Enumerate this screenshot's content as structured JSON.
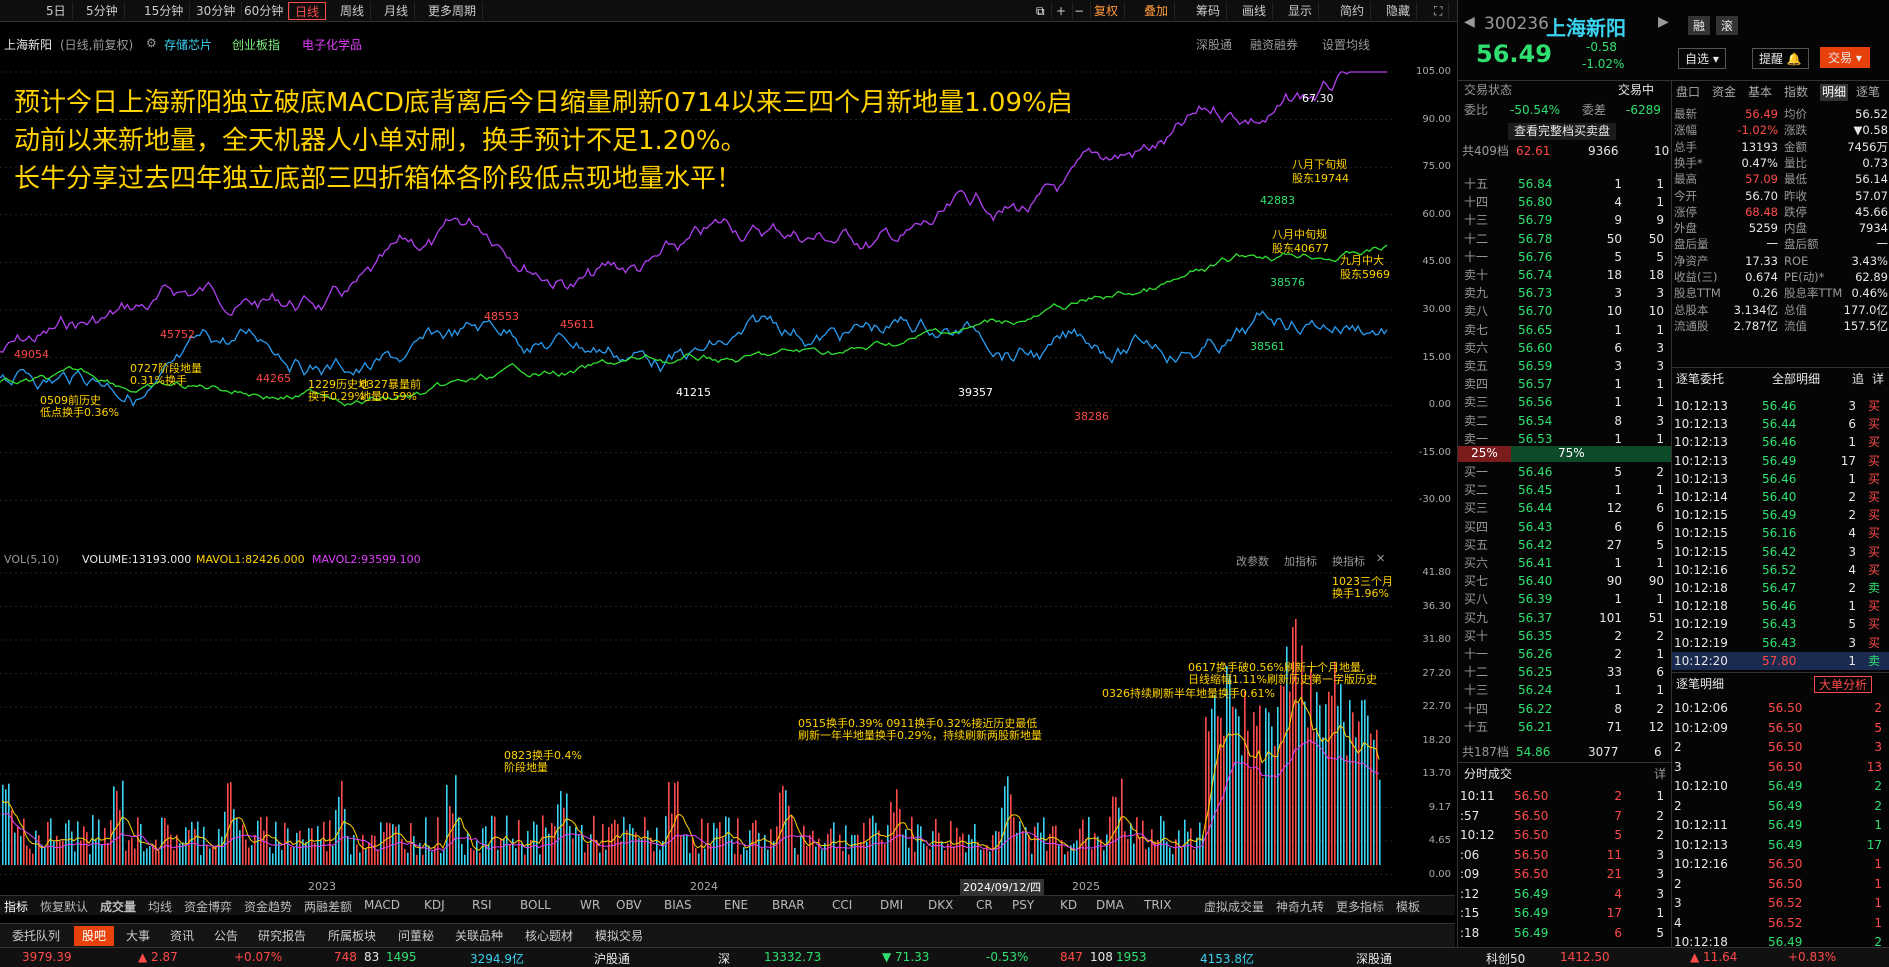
{
  "toolbar": {
    "items": [
      "日线",
      "5日",
      "5分钟",
      "15分钟",
      "30分钟",
      "60分钟",
      "日线",
      "周线",
      "月线",
      "更多周期"
    ],
    "right": [
      "复权",
      "叠加",
      "筹码",
      "画线",
      "显示",
      "简约",
      "隐藏"
    ]
  },
  "chart_header": {
    "stock": "上海新阳",
    "mode": "(日线,前复权)",
    "tags": [
      "存储芯片",
      "创业板指",
      "电子化学品"
    ],
    "right": [
      "深股通",
      "融资融券",
      "设置均线"
    ]
  },
  "announcement": [
    "预计今日上海新阳独立破底MACD底背离后今日缩量刷新0714以来三四个月新地量1.09%启",
    "动前以来新地量，全天机器人小单对刷，换手预计不足1.20%。",
    "长牛分享过去四年独立底部三四折箱体各阶段低点现地量水平！"
  ],
  "price_axis": [
    "105.00",
    "90.00",
    "75.00",
    "60.00",
    "45.00",
    "30.00",
    "15.00",
    "0.00",
    "-15.00",
    "-30.00"
  ],
  "price_annotations": [
    {
      "t": "67.30",
      "c": "white"
    },
    {
      "t": "八月下旬规",
      "c": "yellow"
    },
    {
      "t": "股东19744",
      "c": "yellow"
    },
    {
      "t": "八月中旬规",
      "c": "yellow"
    },
    {
      "t": "股东40677",
      "c": "yellow"
    },
    {
      "t": "九月中大",
      "c": "yellow"
    },
    {
      "t": "股东5969",
      "c": "yellow"
    },
    {
      "t": "42883",
      "c": "green"
    },
    {
      "t": "38576",
      "c": "green"
    },
    {
      "t": "38561",
      "c": "green"
    },
    {
      "t": "0509前历史",
      "c": "yellow"
    },
    {
      "t": "低点换手0.36%",
      "c": "yellow"
    },
    {
      "t": "0727阶段地量",
      "c": "yellow"
    },
    {
      "t": "0.31%换手",
      "c": "yellow"
    },
    {
      "t": "1229历史地",
      "c": "yellow"
    },
    {
      "t": "换手0.29%",
      "c": "yellow"
    },
    {
      "t": "0327暴量前",
      "c": "yellow"
    },
    {
      "t": "地量0.59%",
      "c": "yellow"
    },
    {
      "t": "49054",
      "c": "red"
    },
    {
      "t": "45752",
      "c": "red"
    },
    {
      "t": "44265",
      "c": "red"
    },
    {
      "t": "48553",
      "c": "red"
    },
    {
      "t": "45611",
      "c": "red"
    },
    {
      "t": "41215",
      "c": "white"
    },
    {
      "t": "39357",
      "c": "white"
    },
    {
      "t": "38286",
      "c": "red"
    }
  ],
  "vol_header": {
    "label": "VOL(5,10)",
    "volume": "VOLUME:13193.000",
    "mavol1": "MAVOL1:82426.000",
    "mavol2": "MAVOL2:93599.100",
    "right": [
      "改参数",
      "加指标",
      "换指标"
    ]
  },
  "vol_axis": [
    "41.80",
    "36.30",
    "31.80",
    "27.20",
    "22.70",
    "18.20",
    "13.70",
    "9.17",
    "4.65",
    "0.00"
  ],
  "vol_annotations": [
    "1023三个月",
    "换手1.96%",
    "0617换手破0.56%刷新十个月地量,",
    "日线缩幅1.11%刷新历史第一字版历史",
    "0326持续刷新半年地量换手0.61%",
    "0515换手0.39% 0911换手0.32%接近历史最低",
    "刷新一年半地量换手0.29%，持续刷新两股新地量",
    "0823换手0.4%",
    "阶段地量"
  ],
  "xaxis": [
    "2023",
    "2024",
    "2024/09/12/四",
    "2025"
  ],
  "indicators": [
    "指标",
    "恢复默认",
    "成交量",
    "均线",
    "资金博弈",
    "资金趋势",
    "两融差额",
    "MACD",
    "KDJ",
    "RSI",
    "BOLL",
    "WR",
    "OBV",
    "BIAS",
    "ENE",
    "BRAR",
    "CCI",
    "DMI",
    "DKX",
    "CR",
    "PSY",
    "KD",
    "DMA",
    "TRIX",
    "虚拟成交量",
    "神奇九转",
    "更多指标",
    "模板"
  ],
  "bottom_tabs": [
    "委托队列",
    "股吧",
    "大事",
    "资讯",
    "公告",
    "研究报告",
    "所属板块",
    "问董秘",
    "关联品种",
    "核心题材",
    "模拟交易"
  ],
  "status": {
    "sh_index": "3979.39",
    "sh_chg": "▲ 2.87",
    "sh_pct": "+0.07%",
    "sh_up": "748",
    "sh_flat": "83",
    "sh_down": "1495",
    "sh_amt": "3294.9亿",
    "hgt": "沪股通",
    "sz_label": "深",
    "sz_index": "13332.73",
    "sz_chg": "▼ 71.33",
    "sz_pct": "-0.53%",
    "sz_up": "847",
    "sz_flat": "108",
    "sz_down": "1953",
    "sz_amt": "4153.8亿",
    "sgt": "深股通",
    "kc_label": "科创50",
    "kc_index": "1412.50",
    "kc_chg": "▲ 11.64",
    "kc_pct": "+0.83%"
  },
  "quote": {
    "code": "300236",
    "name": "上海新阳",
    "price": "56.49",
    "change": "-0.58",
    "pct": "-1.02%",
    "buttons": [
      "融",
      "滚"
    ],
    "selfsel": "自选",
    "alert": "提醒",
    "trade": "交易"
  },
  "status_label": "交易状态",
  "status_value": "交易中",
  "weibi": {
    "label": "委比",
    "value": "-50.54%",
    "label2": "委差",
    "value2": "-6289"
  },
  "full_book": "查看完整档买卖盘",
  "sell_total": {
    "label": "共409档",
    "price": "62.61",
    "vol": "9366",
    "n": "10"
  },
  "asks": [
    [
      "十五",
      "56.84",
      "1",
      "1"
    ],
    [
      "十四",
      "56.80",
      "4",
      "1"
    ],
    [
      "十三",
      "56.79",
      "9",
      "9"
    ],
    [
      "十二",
      "56.78",
      "50",
      "50"
    ],
    [
      "十一",
      "56.76",
      "5",
      "5"
    ],
    [
      "卖十",
      "56.74",
      "18",
      "18"
    ],
    [
      "卖九",
      "56.73",
      "3",
      "3"
    ],
    [
      "卖八",
      "56.70",
      "10",
      "10"
    ],
    [
      "卖七",
      "56.65",
      "1",
      "1"
    ],
    [
      "卖六",
      "56.60",
      "6",
      "3"
    ],
    [
      "卖五",
      "56.59",
      "3",
      "3"
    ],
    [
      "卖四",
      "56.57",
      "1",
      "1"
    ],
    [
      "卖三",
      "56.56",
      "1",
      "1"
    ],
    [
      "卖二",
      "56.54",
      "8",
      "3"
    ],
    [
      "卖一",
      "56.53",
      "1",
      "1"
    ]
  ],
  "ratio": {
    "left": "25%",
    "right": "75%"
  },
  "bids": [
    [
      "买一",
      "56.46",
      "5",
      "2"
    ],
    [
      "买二",
      "56.45",
      "1",
      "1"
    ],
    [
      "买三",
      "56.44",
      "12",
      "6"
    ],
    [
      "买四",
      "56.43",
      "6",
      "6"
    ],
    [
      "买五",
      "56.42",
      "27",
      "5"
    ],
    [
      "买六",
      "56.41",
      "1",
      "1"
    ],
    [
      "买七",
      "56.40",
      "90",
      "90"
    ],
    [
      "买八",
      "56.39",
      "1",
      "1"
    ],
    [
      "买九",
      "56.37",
      "101",
      "51"
    ],
    [
      "买十",
      "56.35",
      "2",
      "2"
    ],
    [
      "十一",
      "56.26",
      "2",
      "1"
    ],
    [
      "十二",
      "56.25",
      "33",
      "6"
    ],
    [
      "十三",
      "56.24",
      "1",
      "1"
    ],
    [
      "十四",
      "56.22",
      "8",
      "2"
    ],
    [
      "十五",
      "56.21",
      "71",
      "12"
    ]
  ],
  "buy_total": {
    "label": "共187档",
    "price": "54.86",
    "vol": "3077",
    "n": "6"
  },
  "tick_title": "分时成交",
  "tick_more": "详",
  "ticks": [
    [
      "10:11",
      "56.50",
      "2",
      "1"
    ],
    [
      ":57",
      "56.50",
      "7",
      "2"
    ],
    [
      "10:12",
      "56.50",
      "5",
      "2"
    ],
    [
      ":06",
      "56.50",
      "11",
      "3"
    ],
    [
      ":09",
      "56.50",
      "21",
      "3"
    ],
    [
      ":12",
      "56.49",
      "4",
      "3"
    ],
    [
      ":15",
      "56.49",
      "17",
      "1"
    ],
    [
      ":18",
      "56.49",
      "6",
      "5"
    ]
  ],
  "tabs_right": [
    "盘口",
    "资金",
    "基本",
    "指数",
    "明细",
    "逐笔"
  ],
  "stats": [
    [
      "最新",
      "56.49",
      "均价",
      "56.52"
    ],
    [
      "涨幅",
      "-1.02%",
      "涨跌",
      "▼0.58"
    ],
    [
      "总手",
      "13193",
      "金额",
      "7456万"
    ],
    [
      "换手*",
      "0.47%",
      "量比",
      "0.73"
    ],
    [
      "最高",
      "57.09",
      "最低",
      "56.14"
    ],
    [
      "今开",
      "56.70",
      "昨收",
      "57.07"
    ],
    [
      "涨停",
      "68.48",
      "跌停",
      "45.66"
    ],
    [
      "外盘",
      "5259",
      "内盘",
      "7934"
    ],
    [
      "盘后量",
      "一",
      "盘后额",
      "一"
    ],
    [
      "净资产",
      "17.33",
      "ROE",
      "3.43%"
    ],
    [
      "收益(三)",
      "0.674",
      "PE(动)*",
      "62.89"
    ],
    [
      "股息TTM",
      "0.26",
      "股息率TTM",
      "0.46%"
    ],
    [
      "总股本",
      "3.134亿",
      "总值",
      "177.0亿"
    ],
    [
      "流通股",
      "2.787亿",
      "流值",
      "157.5亿"
    ]
  ],
  "entrust_title": "逐笔委托",
  "entrust_filter": "全部明细",
  "entrust_btns": [
    "追",
    "详"
  ],
  "entrust": [
    [
      "10:12:13",
      "56.46",
      "3",
      "买"
    ],
    [
      "10:12:13",
      "56.44",
      "6",
      "买"
    ],
    [
      "10:12:13",
      "56.46",
      "1",
      "买"
    ],
    [
      "10:12:13",
      "56.49",
      "17",
      "买"
    ],
    [
      "10:12:13",
      "56.46",
      "1",
      "买"
    ],
    [
      "10:12:14",
      "56.40",
      "2",
      "买"
    ],
    [
      "10:12:15",
      "56.49",
      "2",
      "买"
    ],
    [
      "10:12:15",
      "56.16",
      "4",
      "买"
    ],
    [
      "10:12:15",
      "56.42",
      "3",
      "买"
    ],
    [
      "10:12:16",
      "56.52",
      "4",
      "买"
    ],
    [
      "10:12:18",
      "56.47",
      "2",
      "卖"
    ],
    [
      "10:12:18",
      "56.46",
      "1",
      "买"
    ],
    [
      "10:12:19",
      "56.43",
      "5",
      "买"
    ],
    [
      "10:12:19",
      "56.43",
      "3",
      "买"
    ],
    [
      "10:12:20",
      "57.80",
      "1",
      "卖"
    ]
  ],
  "detail_title": "逐笔明细",
  "detail_btn": "大单分析",
  "details": [
    [
      "10:12:06",
      "56.50",
      "2"
    ],
    [
      "10:12:09",
      "56.50",
      "5"
    ],
    [
      "2",
      "56.50",
      "3"
    ],
    [
      "3",
      "56.50",
      "13"
    ],
    [
      "10:12:10",
      "56.49",
      "2"
    ],
    [
      "2",
      "56.49",
      "2"
    ],
    [
      "10:12:11",
      "56.49",
      "1"
    ],
    [
      "10:12:13",
      "56.49",
      "17"
    ],
    [
      "10:12:16",
      "56.50",
      "1"
    ],
    [
      "2",
      "56.50",
      "1"
    ],
    [
      "3",
      "56.52",
      "1"
    ],
    [
      "4",
      "56.52",
      "1"
    ],
    [
      "10:12:18",
      "56.49",
      "2"
    ]
  ]
}
